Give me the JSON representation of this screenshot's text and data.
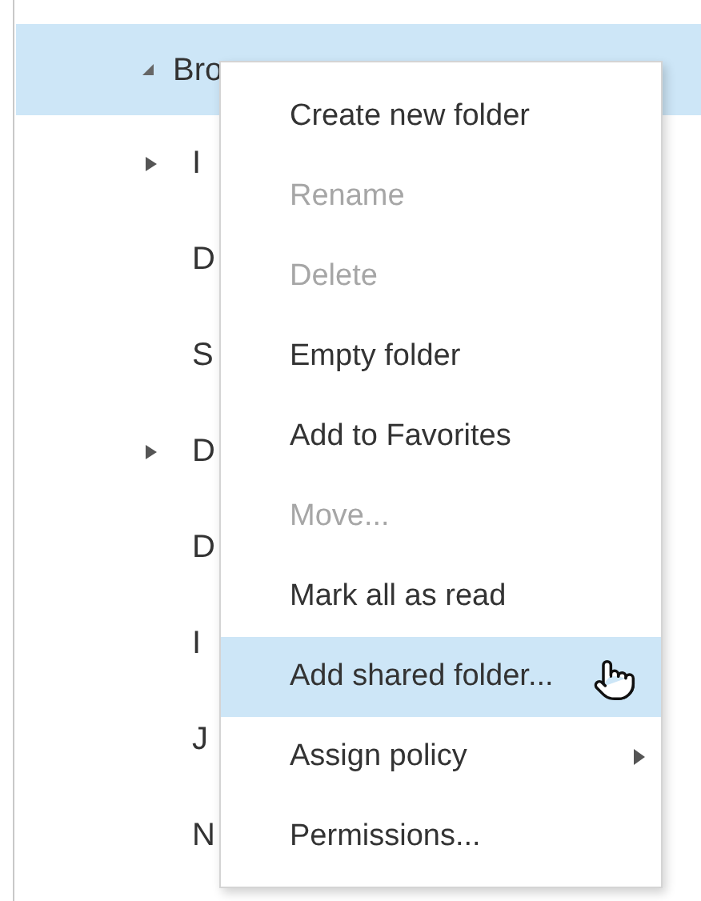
{
  "tree": {
    "label": "Bro",
    "expanded": true,
    "selected": true,
    "children": [
      {
        "label": "I",
        "has_children": true
      },
      {
        "label": "D",
        "has_children": false
      },
      {
        "label": "S",
        "has_children": false
      },
      {
        "label": "D",
        "has_children": true
      },
      {
        "label": "D",
        "has_children": false
      },
      {
        "label": "I",
        "has_children": false
      },
      {
        "label": "J",
        "has_children": false
      },
      {
        "label": "N",
        "has_children": false
      }
    ]
  },
  "context_menu": {
    "items": [
      {
        "label": "Create new folder",
        "disabled": false,
        "selected": false,
        "submenu": false
      },
      {
        "label": "Rename",
        "disabled": true,
        "selected": false,
        "submenu": false
      },
      {
        "label": "Delete",
        "disabled": true,
        "selected": false,
        "submenu": false
      },
      {
        "label": "Empty folder",
        "disabled": false,
        "selected": false,
        "submenu": false
      },
      {
        "label": "Add to Favorites",
        "disabled": false,
        "selected": false,
        "submenu": false
      },
      {
        "label": "Move...",
        "disabled": true,
        "selected": false,
        "submenu": false
      },
      {
        "label": "Mark all as read",
        "disabled": false,
        "selected": false,
        "submenu": false
      },
      {
        "label": "Add shared folder...",
        "disabled": false,
        "selected": true,
        "submenu": false
      },
      {
        "label": "Assign policy",
        "disabled": false,
        "selected": false,
        "submenu": true
      },
      {
        "label": "Permissions...",
        "disabled": false,
        "selected": false,
        "submenu": false
      }
    ]
  }
}
